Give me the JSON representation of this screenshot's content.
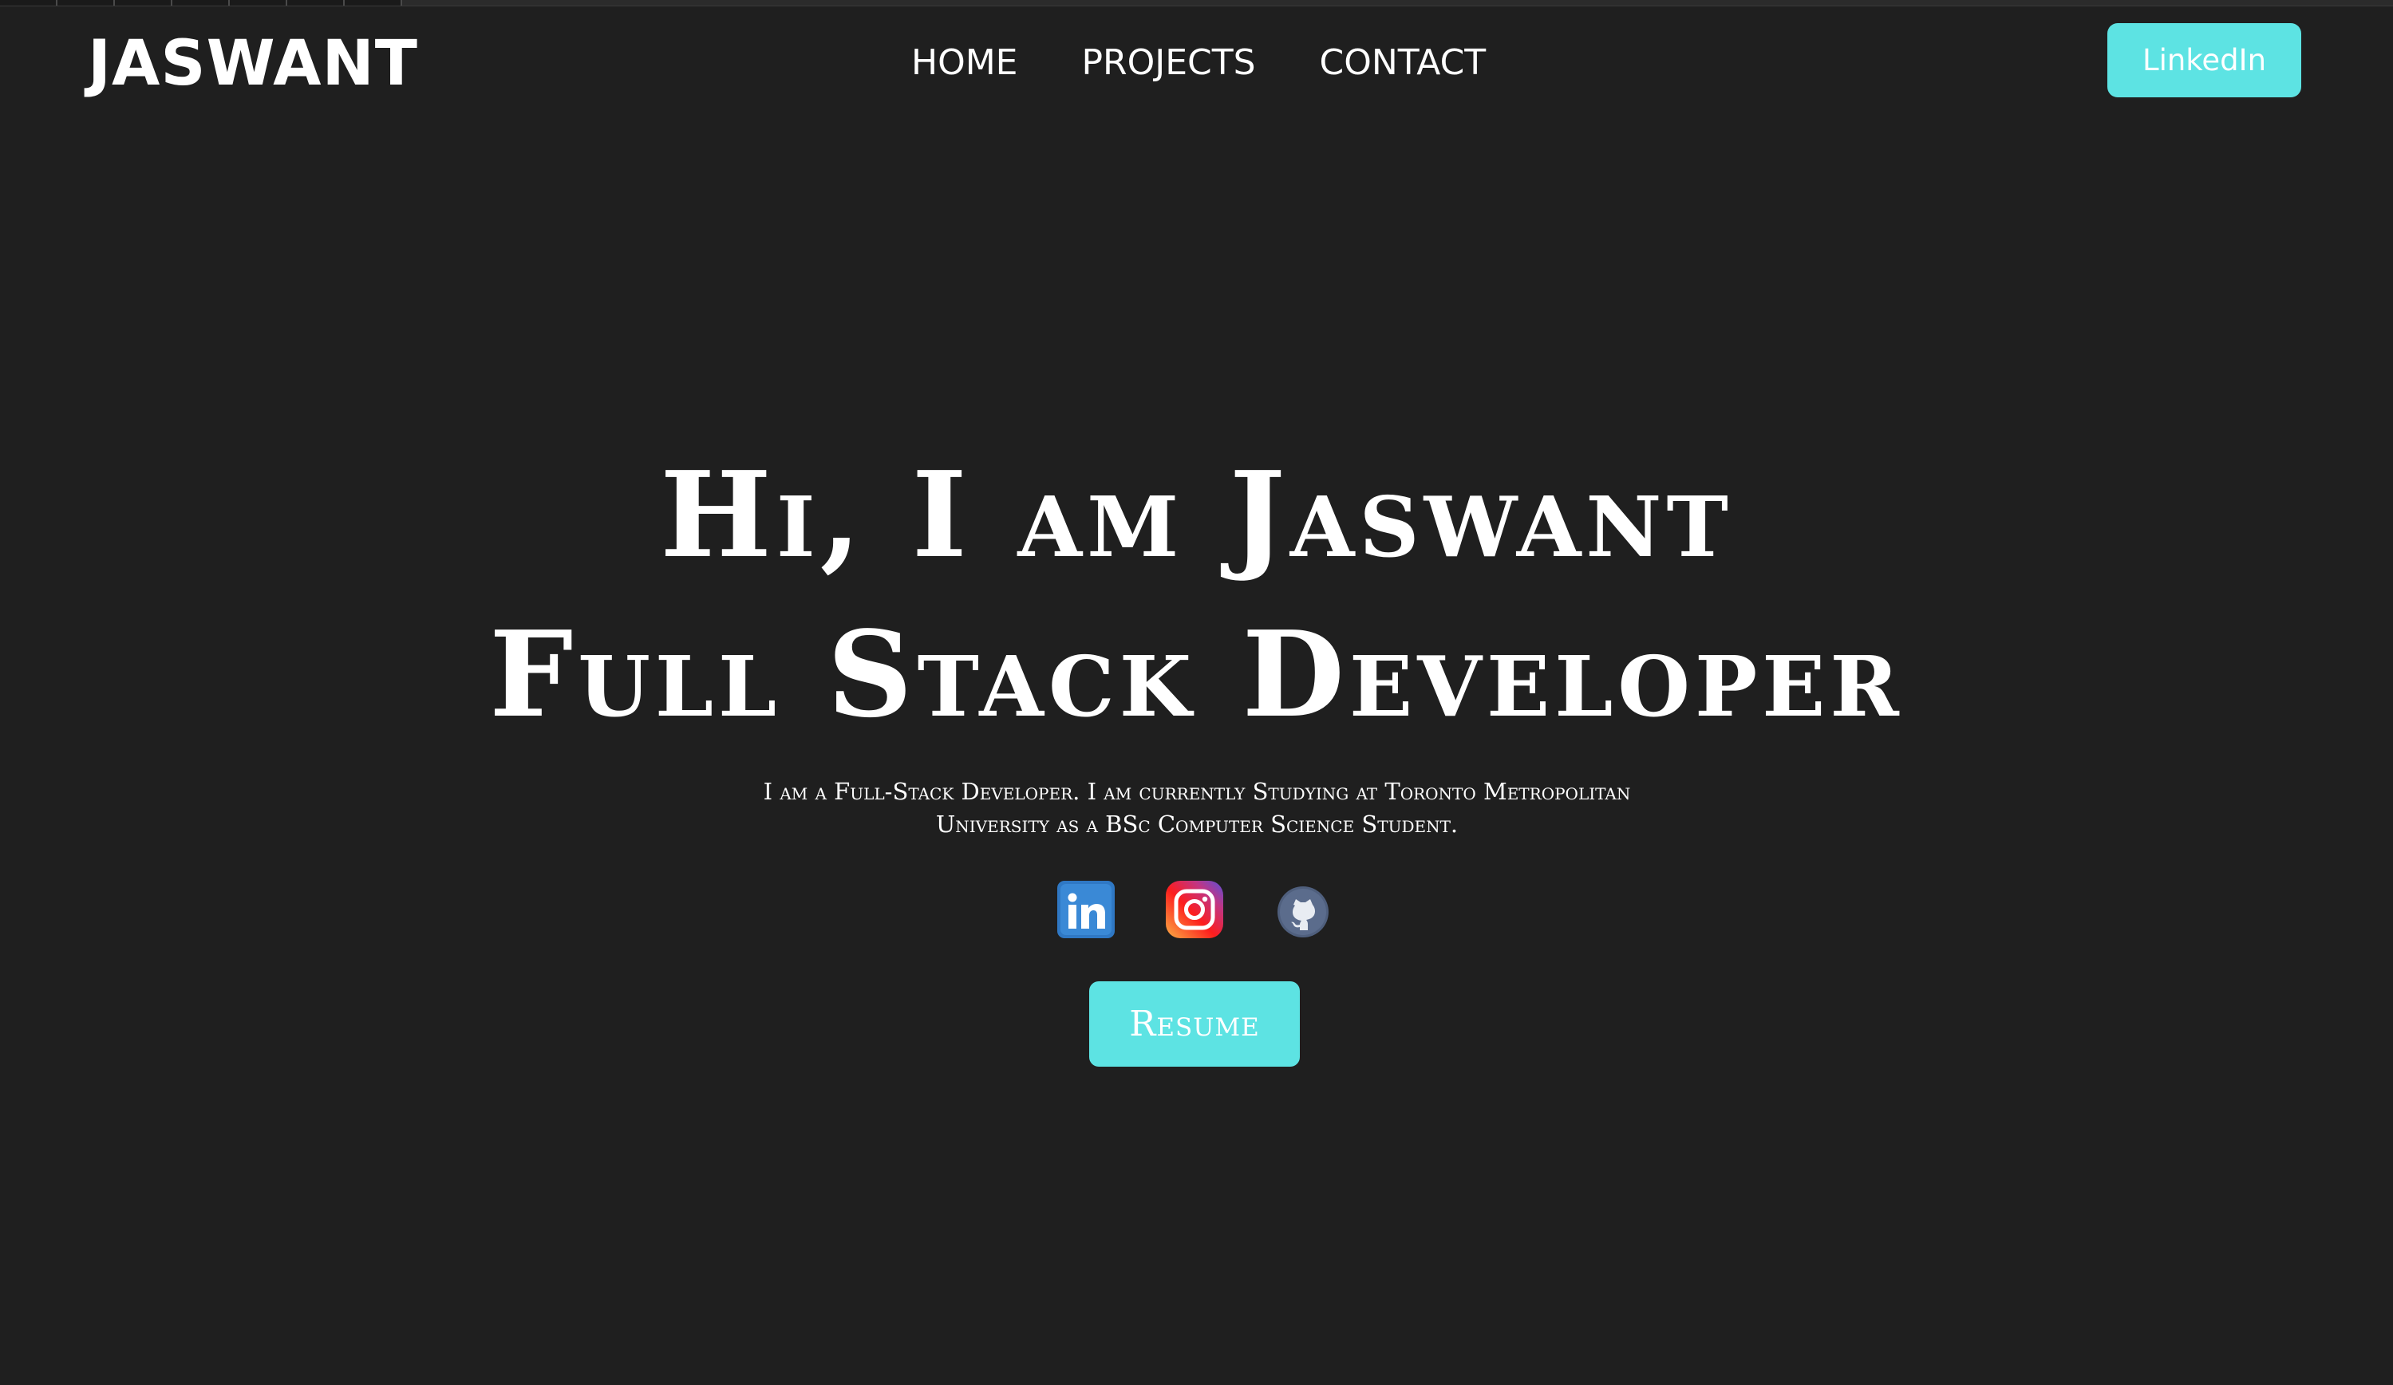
{
  "header": {
    "logo": "JASWANT",
    "nav": [
      {
        "label": "HOME"
      },
      {
        "label": "PROJECTS"
      },
      {
        "label": "CONTACT"
      }
    ],
    "cta_label": "LinkedIn"
  },
  "hero": {
    "line1": "Hi, I am Jaswant",
    "line2": "Full Stack Developer",
    "bio_line1": "I am a Full-Stack Developer. I am currently Studying at Toronto Metropolitan",
    "bio_line2": "University as a BSc Computer Science Student.",
    "socials": [
      {
        "icon": "linkedin-icon"
      },
      {
        "icon": "instagram-icon"
      },
      {
        "icon": "github-icon"
      }
    ],
    "resume_label": "Resume"
  },
  "colors": {
    "background": "#1f1f1f",
    "accent": "#5de3e3",
    "text": "#ffffff"
  }
}
